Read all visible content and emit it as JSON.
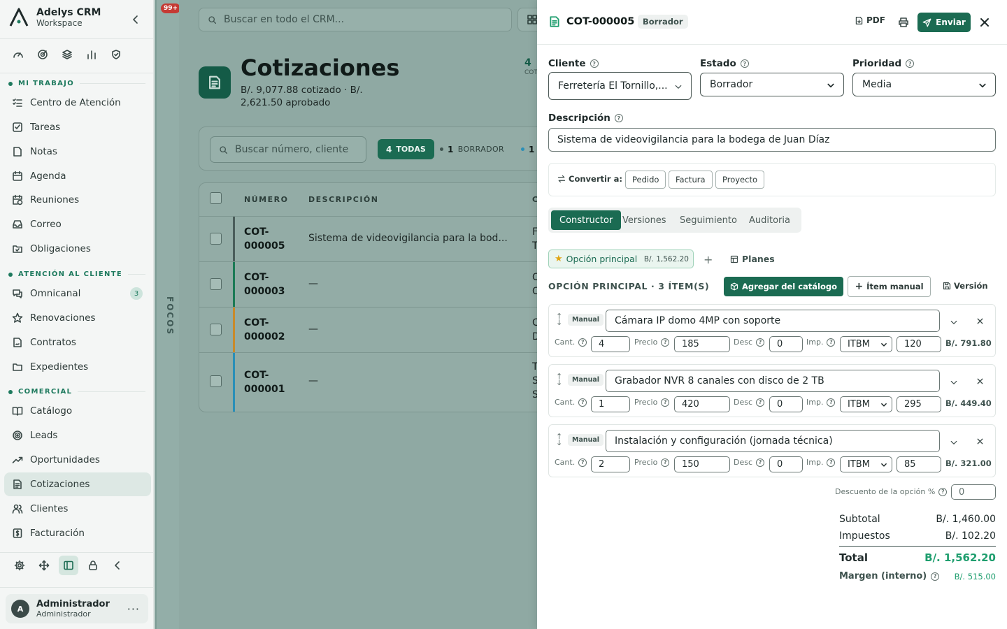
{
  "sidebar": {
    "brand_title": "Adelys CRM",
    "brand_sub": "Workspace",
    "sections": [
      {
        "label": "MI TRABAJO"
      },
      {
        "label": "ATENCIÓN AL CLIENTE"
      },
      {
        "label": "COMERCIAL"
      }
    ],
    "items": [
      {
        "label": "Centro de Atención",
        "icon": "list-check-icon"
      },
      {
        "label": "Tareas",
        "icon": "checkbox-icon"
      },
      {
        "label": "Notas",
        "icon": "note-icon"
      },
      {
        "label": "Agenda",
        "icon": "calendar-icon"
      },
      {
        "label": "Reuniones",
        "icon": "calendar-clock-icon"
      },
      {
        "label": "Correo",
        "icon": "inbox-icon"
      },
      {
        "label": "Obligaciones",
        "icon": "folder-check-icon"
      },
      {
        "label": "Omnicanal",
        "icon": "chat-icon",
        "badge": "3"
      },
      {
        "label": "Renovaciones",
        "icon": "star-icon"
      },
      {
        "label": "Contratos",
        "icon": "contract-icon"
      },
      {
        "label": "Expedientes",
        "icon": "folder-icon"
      },
      {
        "label": "Catálogo",
        "icon": "book-icon"
      },
      {
        "label": "Leads",
        "icon": "target-icon"
      },
      {
        "label": "Oportunidades",
        "icon": "trend-icon"
      },
      {
        "label": "Cotizaciones",
        "icon": "document-icon",
        "active": true
      },
      {
        "label": "Clientes",
        "icon": "users-icon"
      },
      {
        "label": "Facturación",
        "icon": "invoice-icon"
      }
    ],
    "user": {
      "initial": "A",
      "name": "Administrador",
      "role": "Administrador"
    }
  },
  "focos": {
    "badge": "99+",
    "label": "FOCOS"
  },
  "main": {
    "search_placeholder": "Buscar en todo el CRM...",
    "title": "Cotizaciones",
    "subtitle": "B/. 9,077.88 cotizado · B/. 2,621.50 aprobado",
    "kpi_value": "4",
    "kpi_label": "COT",
    "list_search_placeholder": "Buscar número, cliente",
    "filters": {
      "all_count": "4",
      "all_label": "TODAS",
      "draft_count": "1",
      "draft_label": "BORRADOR",
      "next_count": "1"
    },
    "columns": {
      "number": "NÚMERO",
      "description": "DESCRIPCIÓN",
      "client": "C"
    },
    "rows": [
      {
        "number": "COT-000005",
        "n1": "COT-",
        "n2": "000005",
        "description": "Sistema de videovigilancia para la bod...",
        "client1": "F",
        "client2": "T",
        "bar": "#4a5d5a"
      },
      {
        "number": "COT-000003",
        "n1": "COT-",
        "n2": "000003",
        "description": "—",
        "client1": "C",
        "client2": "C",
        "bar": "#1b7a55"
      },
      {
        "number": "COT-000002",
        "n1": "COT-",
        "n2": "000002",
        "description": "—",
        "client1": "C",
        "client2": "D",
        "bar": "#c98a2a"
      },
      {
        "number": "COT-000001",
        "n1": "COT-",
        "n2": "000001",
        "description": "—",
        "client1": "T",
        "client2": "S",
        "client3": "S",
        "bar": "#2a8fb8"
      }
    ]
  },
  "drawer": {
    "number": "COT-000005",
    "status": "Borrador",
    "pdf_label": "PDF",
    "send_label": "Enviar",
    "client_label": "Cliente",
    "client_value": "Ferretería El Tornillo,...",
    "state_label": "Estado",
    "state_value": "Borrador",
    "priority_label": "Prioridad",
    "priority_value": "Media",
    "description_label": "Descripción",
    "description_value": "Sistema de videovigilancia para la bodega de Juan Díaz",
    "convert_label": "Convertir a:",
    "convert_options": [
      "Pedido",
      "Factura",
      "Proyecto"
    ],
    "tabs": [
      "Constructor",
      "Versiones",
      "Seguimiento",
      "Auditoria"
    ],
    "option_name": "Opción principal",
    "option_amount": "B/. 1,562.20",
    "plans_label": "Planes",
    "option_heading": "OPCIÓN PRINCIPAL · 3 ÍTEM(S)",
    "add_catalog_label": "Agregar del catálogo",
    "add_manual_label": "Ítem manual",
    "version_label": "Versión",
    "field_labels": {
      "qty": "Cant.",
      "price": "Precio",
      "disc": "Desc",
      "tax": "Imp."
    },
    "items": [
      {
        "tag": "Manual",
        "name": "Cámara IP domo 4MP con soporte",
        "qty": "4",
        "price": "185",
        "disc": "0",
        "tax": "ITBM",
        "cost": "120",
        "total": "B/. 791.80"
      },
      {
        "tag": "Manual",
        "name": "Grabador NVR 8 canales con disco de 2 TB",
        "qty": "1",
        "price": "420",
        "disc": "0",
        "tax": "ITBM",
        "cost": "295",
        "total": "B/. 449.40"
      },
      {
        "tag": "Manual",
        "name": "Instalación y configuración (jornada técnica)",
        "qty": "2",
        "price": "150",
        "disc": "0",
        "tax": "ITBM",
        "cost": "85",
        "total": "B/. 321.00"
      }
    ],
    "option_discount_label": "Descuento de la opción %",
    "option_discount_value": "0",
    "totals": {
      "subtotal_label": "Subtotal",
      "subtotal": "B/. 1,460.00",
      "taxes_label": "Impuestos",
      "taxes": "B/. 102.20",
      "total_label": "Total",
      "total": "B/. 1,562.20",
      "margin_label": "Margen (interno)",
      "margin": "B/. 515.00"
    }
  },
  "colors": {
    "brand": "#1b6b52",
    "accent_text": "#1e9e6e"
  }
}
